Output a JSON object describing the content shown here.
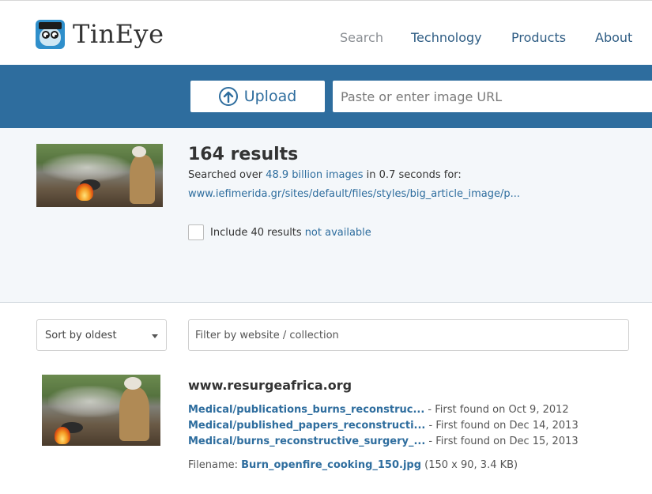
{
  "header": {
    "logo_text": "TinEye",
    "nav": [
      {
        "label": "Search"
      },
      {
        "label": "Technology"
      },
      {
        "label": "Products"
      },
      {
        "label": "About"
      }
    ]
  },
  "upload": {
    "button_label": "Upload",
    "url_placeholder": "Paste or enter image URL"
  },
  "summary": {
    "count": "164 results",
    "searched_prefix": "Searched over ",
    "searched_link": "48.9 billion images",
    "searched_suffix": " in 0.7 seconds for:",
    "query_url": "www.iefimerida.gr/sites/default/files/styles/big_article_image/p...",
    "include_prefix": "Include 40 results",
    "include_link": "not available"
  },
  "filters": {
    "sort_value": "Sort by oldest",
    "filter_placeholder": "Filter by website / collection"
  },
  "result": {
    "domain": "www.resurgeafrica.org",
    "matches": [
      {
        "link": "Medical/publications_burns_reconstruc...",
        "found": " - First found on Oct 9, 2012"
      },
      {
        "link": "Medical/published_papers_reconstructi...",
        "found": " - First found on Dec 14, 2013"
      },
      {
        "link": "Medical/burns_reconstructive_surgery_...",
        "found": " - First found on Dec 15, 2013"
      }
    ],
    "filename_prefix": "Filename: ",
    "filename_link": "Burn_openfire_cooking_150.jpg",
    "filename_suffix": " (150 x 90, 3.4 KB)"
  }
}
